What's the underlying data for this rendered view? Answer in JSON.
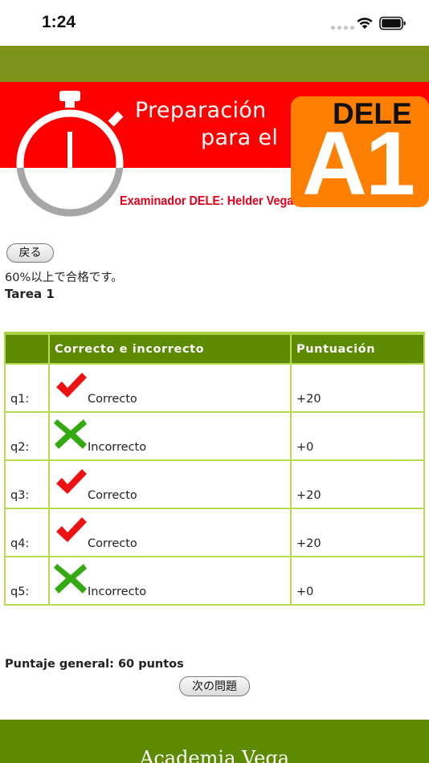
{
  "status_bar": {
    "time": "1:24"
  },
  "banner": {
    "title_line1": "Preparación",
    "title_line2": "para el",
    "examiner": "Examinador DELE: Helder Vega",
    "badge_top": "DELE",
    "badge_level": "A1",
    "colors": {
      "red": "#ff0000",
      "orange": "#ff7f00",
      "gray": "#a6a6a6"
    }
  },
  "back_button": "戻る",
  "pass_note": "60%以上で合格です。",
  "task_title": "Tarea 1",
  "table": {
    "headers": [
      "",
      "Correcto e incorrecto",
      "Puntuación"
    ],
    "rows": [
      {
        "q": "q1:",
        "icon": "check-icon",
        "result": "Correcto",
        "score": "+20"
      },
      {
        "q": "q2:",
        "icon": "cross-icon",
        "result": "Incorrecto",
        "score": "+0"
      },
      {
        "q": "q3:",
        "icon": "check-icon",
        "result": "Correcto",
        "score": "+20"
      },
      {
        "q": "q4:",
        "icon": "check-icon",
        "result": "Correcto",
        "score": "+20"
      },
      {
        "q": "q5:",
        "icon": "cross-icon",
        "result": "Incorrecto",
        "score": "+0"
      }
    ]
  },
  "total_score": "Puntaje general: 60 puntos",
  "next_button": "次の問題",
  "footer_title": "Academia Vega",
  "colors": {
    "olive_bar": "#7e931a",
    "header_green": "#5c8a00",
    "table_border": "#b6dc4e",
    "check_red": "#ee1111",
    "cross_green": "#33aa11"
  }
}
